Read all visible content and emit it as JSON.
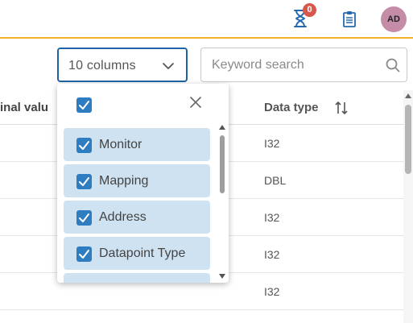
{
  "header": {
    "notifications_badge": "0",
    "avatar_initials": "AD",
    "icons": [
      "hourglass-icon",
      "clipboard-list-icon"
    ]
  },
  "toolbar": {
    "columns_select_value": "10 columns",
    "search_placeholder": "Keyword search"
  },
  "table": {
    "columns": [
      "inal valu",
      "Data type"
    ],
    "rows": [
      {
        "data_type": "I32"
      },
      {
        "data_type": "DBL"
      },
      {
        "data_type": "I32"
      },
      {
        "data_type": "I32"
      },
      {
        "data_type": "I32"
      }
    ]
  },
  "column_picker": {
    "select_all_checked": true,
    "items": [
      {
        "label": "Monitor",
        "checked": true
      },
      {
        "label": "Mapping",
        "checked": true
      },
      {
        "label": "Address",
        "checked": true
      },
      {
        "label": "Datapoint Type",
        "checked": true
      },
      {
        "label": "",
        "checked": true
      }
    ]
  },
  "colors": {
    "accent_primary": "#1e63a8",
    "checkbox": "#2f7dc1",
    "selected_item_bg": "#cfe2f1",
    "header_border": "#f2b12a",
    "badge": "#d7574a",
    "avatar": "#c58ca8"
  }
}
